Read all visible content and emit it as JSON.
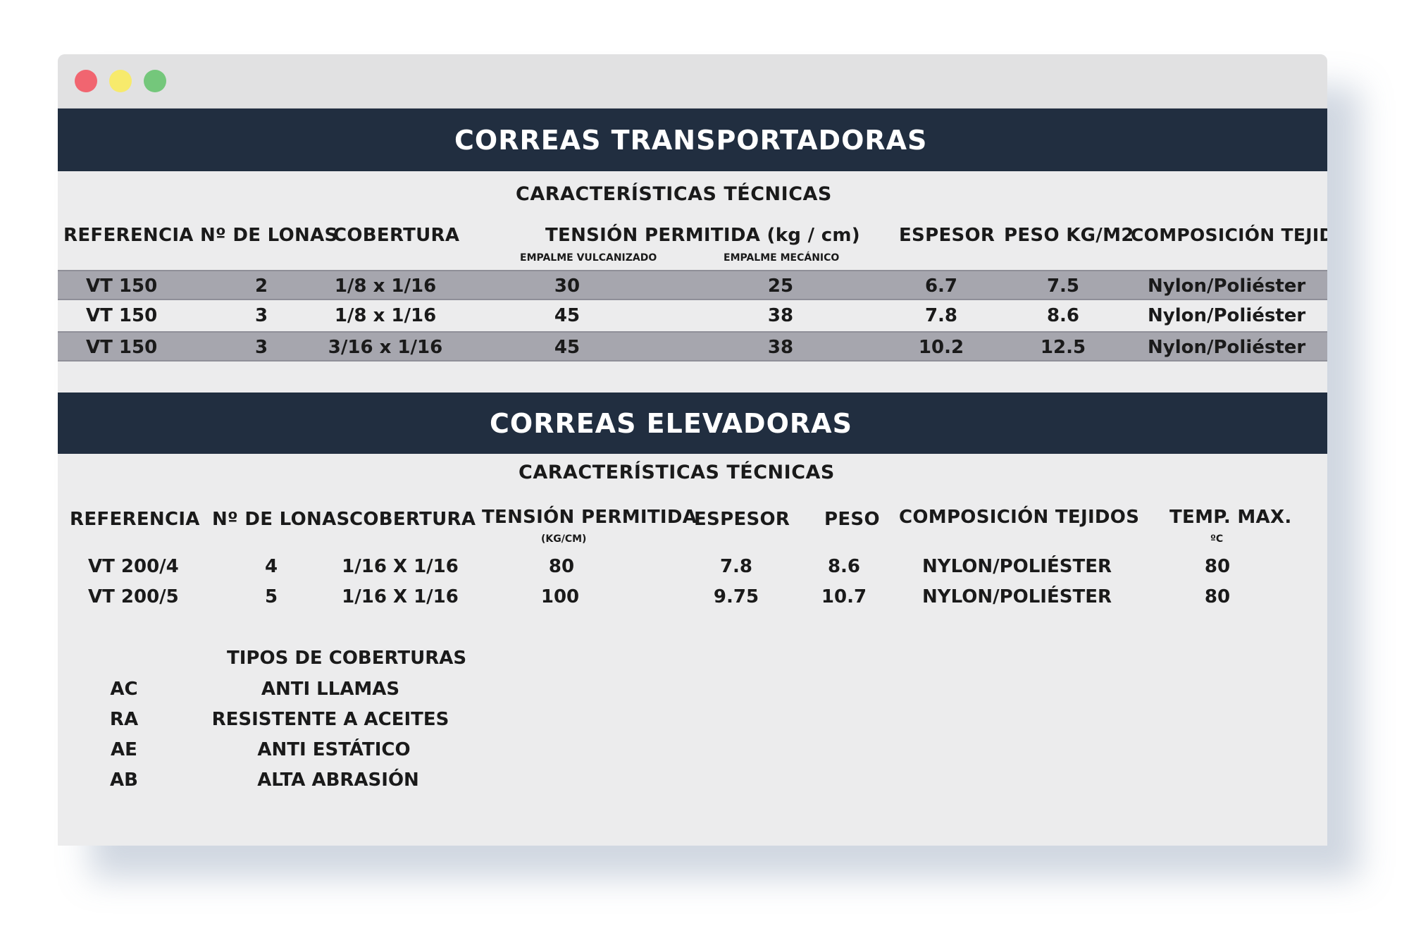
{
  "window": {
    "buttons": [
      "close",
      "minimize",
      "maximize"
    ]
  },
  "conveyor": {
    "title": "CORREAS  TRANSPORTADORAS",
    "subtitle": "CARACTERÍSTICAS TÉCNICAS",
    "headers": {
      "ref": "REFERENCIA",
      "plies": "Nº DE LONAS",
      "cover": "COBERTURA",
      "tension": "TENSIÓN PERMITIDA (kg / cm)",
      "tension_vulc": "EMPALME VULCANIZADO",
      "tension_mech": "EMPALME MECÁNICO",
      "thickness": "ESPESOR",
      "weight": "PESO KG/M2",
      "fabric": "COMPOSICIÓN TEJIDOS"
    },
    "rows": [
      {
        "ref": "VT 150",
        "plies": "2",
        "cover": "1/8 x 1/16",
        "vulc": "30",
        "mech": "25",
        "thickness": "6.7",
        "weight": "7.5",
        "fabric": "Nylon/Poliéster"
      },
      {
        "ref": "VT 150",
        "plies": "3",
        "cover": "1/8 x 1/16",
        "vulc": "45",
        "mech": "38",
        "thickness": "7.8",
        "weight": "8.6",
        "fabric": "Nylon/Poliéster"
      },
      {
        "ref": "VT 150",
        "plies": "3",
        "cover": "3/16 x 1/16",
        "vulc": "45",
        "mech": "38",
        "thickness": "10.2",
        "weight": "12.5",
        "fabric": "Nylon/Poliéster"
      }
    ]
  },
  "elevator": {
    "title": "CORREAS ELEVADORAS",
    "subtitle": "CARACTERÍSTICAS TÉCNICAS",
    "headers": {
      "ref": "REFERENCIA",
      "plies": "Nº DE LONAS",
      "cover": "COBERTURA",
      "tension": "TENSIÓN PERMITIDA",
      "tension_unit": "(KG/CM)",
      "thickness": "ESPESOR",
      "weight": "PESO",
      "fabric": "COMPOSICIÓN TEJIDOS",
      "temp": "TEMP. MAX.",
      "temp_unit": "ºC"
    },
    "rows": [
      {
        "ref": "VT 200/4",
        "plies": "4",
        "cover": "1/16 X 1/16",
        "tension": "80",
        "thickness": "7.8",
        "weight": "8.6",
        "fabric": "NYLON/POLIÉSTER",
        "temp": "80"
      },
      {
        "ref": "VT 200/5",
        "plies": "5",
        "cover": "1/16 X 1/16",
        "tension": "100",
        "thickness": "9.75",
        "weight": "10.7",
        "fabric": "NYLON/POLIÉSTER",
        "temp": "80"
      }
    ]
  },
  "cover_types": {
    "title": "TIPOS DE COBERTURAS",
    "items": [
      {
        "code": "AC",
        "label": "ANTI LLAMAS"
      },
      {
        "code": "RA",
        "label": "RESISTENTE A ACEITES"
      },
      {
        "code": "AE",
        "label": "ANTI ESTÁTICO"
      },
      {
        "code": "AB",
        "label": "ALTA ABRASIÓN"
      }
    ]
  }
}
